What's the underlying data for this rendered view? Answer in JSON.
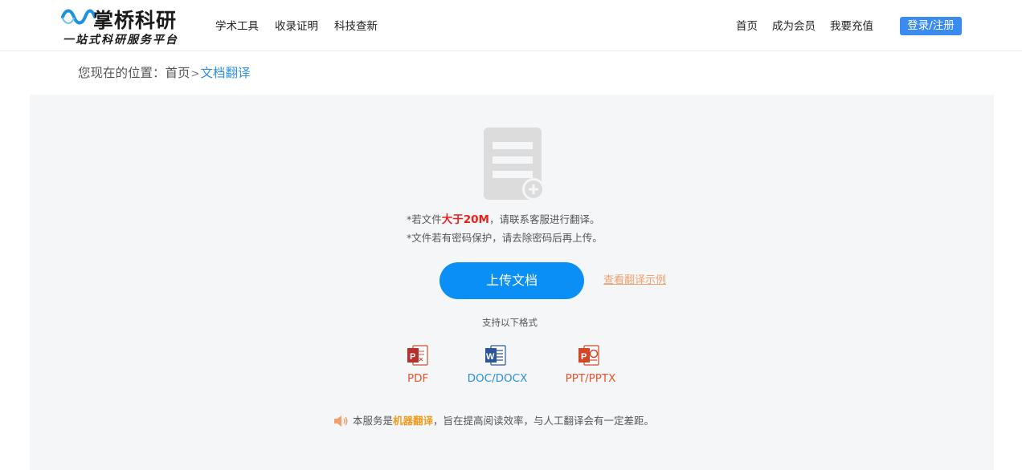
{
  "header": {
    "logo_title": "掌桥科研",
    "logo_subtitle": "一站式科研服务平台",
    "nav_left": [
      "学术工具",
      "收录证明",
      "科技查新"
    ],
    "nav_right": [
      "首页",
      "成为会员",
      "我要充值"
    ],
    "login_label": "登录/注册"
  },
  "breadcrumb": {
    "prefix": "您现在的位置：",
    "home": "首页",
    "separator": ">",
    "current": "文档翻译"
  },
  "upload": {
    "note1_pre": "*若文件",
    "note1_em": "大于20M",
    "note1_post": "，请联系客服进行翻译。",
    "note2": "*文件若有密码保护，请去除密码后再上传。",
    "button_label": "上传文档",
    "example_link": "查看翻译示例",
    "formats_title": "支持以下格式",
    "formats": [
      {
        "label": "PDF",
        "icon": "pdf-file-icon"
      },
      {
        "label": "DOC/DOCX",
        "icon": "word-file-icon"
      },
      {
        "label": "PPT/PPTX",
        "icon": "powerpoint-file-icon"
      }
    ]
  },
  "notice": {
    "pre": "本服务是",
    "highlight": "机器翻译",
    "post": "，旨在提高阅读效率，与人工翻译会有一定差距。"
  },
  "colors": {
    "primary": "#0a8ff7",
    "login_bg": "#3a8bf0",
    "breadcrumb_current": "#2f8fe0",
    "warning_red": "#e8221c",
    "link_orange": "#f3a06e",
    "highlight_orange": "#f39a1c",
    "panel_bg": "#f5f6f8"
  }
}
